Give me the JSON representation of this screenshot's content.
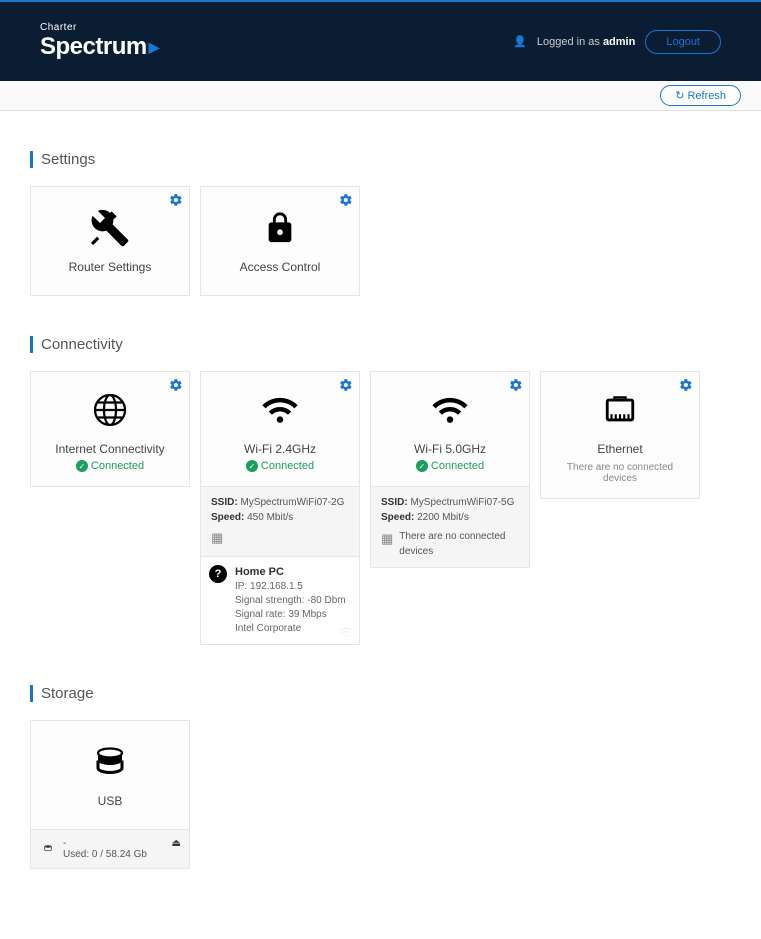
{
  "header": {
    "logo_top": "Charter",
    "logo_main": "Spectrum",
    "logged_in_prefix": "Logged in as ",
    "username": "admin",
    "logout_label": "Logout"
  },
  "subbar": {
    "refresh_label": "Refresh"
  },
  "sections": {
    "settings": {
      "title": "Settings",
      "cards": {
        "router": "Router Settings",
        "access": "Access Control"
      }
    },
    "connectivity": {
      "title": "Connectivity",
      "internet": {
        "title": "Internet Connectivity",
        "status": "Connected"
      },
      "wifi24": {
        "title": "Wi-Fi 2.4GHz",
        "status": "Connected",
        "ssid_label": "SSID:",
        "ssid": "MySpectrumWiFi07-2G",
        "speed_label": "Speed:",
        "speed": "450 Mbit/s",
        "device": {
          "name": "Home PC",
          "ip_label": "IP:",
          "ip": "192.168.1.5",
          "signal_strength_label": "Signal strength:",
          "signal_strength": "-80 Dbm",
          "signal_rate_label": "Signal rate:",
          "signal_rate": "39 Mbps",
          "vendor": "Intel Corporate"
        }
      },
      "wifi50": {
        "title": "Wi-Fi 5.0GHz",
        "status": "Connected",
        "ssid_label": "SSID:",
        "ssid": "MySpectrumWiFi07-5G",
        "speed_label": "Speed:",
        "speed": "2200 Mbit/s",
        "no_devices": "There are no connected devices"
      },
      "ethernet": {
        "title": "Ethernet",
        "no_devices": "There are no connected devices"
      }
    },
    "storage": {
      "title": "Storage",
      "usb": {
        "title": "USB",
        "name": "-",
        "used_label": "Used:",
        "used": "0 / 58.24 Gb"
      }
    }
  }
}
